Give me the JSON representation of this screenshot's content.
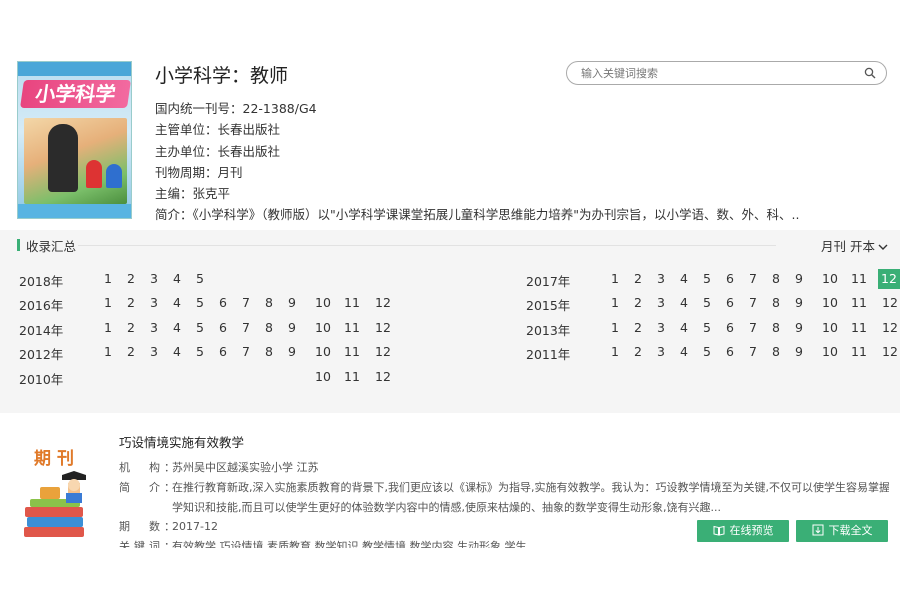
{
  "journal": {
    "title": "小学科学：教师",
    "cover_text": "小学科学",
    "info": [
      "国内统一刊号：22-1388/G4",
      "主管单位：长春出版社",
      "主办单位：长春出版社",
      "刊物周期：月刊",
      "主编：张克平",
      "简介：《小学科学》（教师版）以\"小学科学课课堂拓展儿童科学思维能力培养\"为办刊宗旨，以小学语、数、外、科、.."
    ]
  },
  "search": {
    "placeholder": "输入关键词搜索",
    "icon": "search-icon"
  },
  "archive": {
    "heading": "收录汇总",
    "sort_label": "月刊 开本",
    "accent_color": "#3aaf76",
    "left_years": [
      {
        "year": "2018年",
        "issues": [
          "1",
          "2",
          "3",
          "4",
          "5"
        ]
      },
      {
        "year": "2016年",
        "issues": [
          "1",
          "2",
          "3",
          "4",
          "5",
          "6",
          "7",
          "8",
          "9",
          "10",
          "11",
          "12"
        ]
      },
      {
        "year": "2014年",
        "issues": [
          "1",
          "2",
          "3",
          "4",
          "5",
          "6",
          "7",
          "8",
          "9",
          "10",
          "11",
          "12"
        ]
      },
      {
        "year": "2012年",
        "issues": [
          "1",
          "2",
          "3",
          "4",
          "5",
          "6",
          "7",
          "8",
          "9",
          "10",
          "11",
          "12"
        ]
      },
      {
        "year": "2010年",
        "issues": [
          "10",
          "11",
          "12"
        ]
      }
    ],
    "right_years": [
      {
        "year": "2017年",
        "issues": [
          "1",
          "2",
          "3",
          "4",
          "5",
          "6",
          "7",
          "8",
          "9",
          "10",
          "11",
          "12"
        ],
        "active": "12"
      },
      {
        "year": "2015年",
        "issues": [
          "1",
          "2",
          "3",
          "4",
          "5",
          "6",
          "7",
          "8",
          "9",
          "10",
          "11",
          "12"
        ]
      },
      {
        "year": "2013年",
        "issues": [
          "1",
          "2",
          "3",
          "4",
          "5",
          "6",
          "7",
          "8",
          "9",
          "10",
          "11",
          "12"
        ]
      },
      {
        "year": "2011年",
        "issues": [
          "1",
          "2",
          "3",
          "4",
          "5",
          "6",
          "7",
          "8",
          "9",
          "10",
          "11",
          "12"
        ]
      }
    ]
  },
  "article": {
    "thumb_label": "期刊",
    "title": "巧设情境实施有效教学",
    "meta": [
      {
        "key": "机　构：",
        "value": "苏州吴中区越溪实验小学 江苏"
      },
      {
        "key": "简　介：",
        "value": "在推行教育新政,深入实施素质教育的背景下,我们更应该以《课标》为指导,实施有效教学。我认为：巧设教学情境至为关键,不仅可以使学生容易掌握数"
      },
      {
        "key": "",
        "value": "学知识和技能,而且可以使学生更好的体验数学内容中的情感,使原来枯燥的、抽象的数学变得生动形象,饶有兴趣..."
      },
      {
        "key": "期　数：",
        "value": "2017-12"
      },
      {
        "key": "关键词：",
        "value": "有效教学 巧设情境 素质教育 数学知识 教学情境 数学内容 生动形象 学生"
      }
    ],
    "preview_label": "在线预览",
    "download_label": "下载全文"
  }
}
